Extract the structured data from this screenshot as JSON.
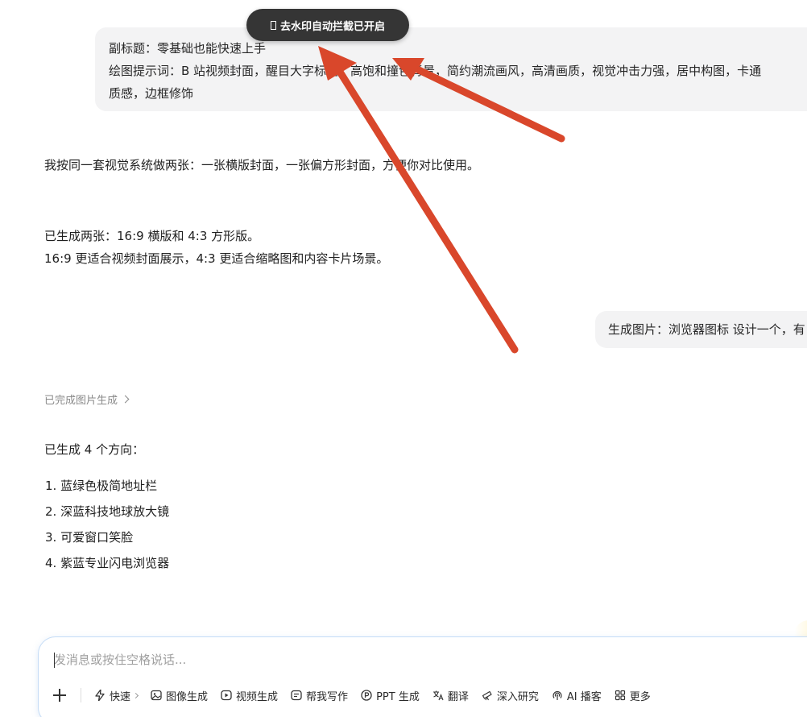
{
  "toast": {
    "text": "去水印自动拦截已开启"
  },
  "user_message_top": {
    "line1": "副标题：零基础也能快速上手",
    "line2": "绘图提示词：B 站视频封面，醒目大字标题，高饱和撞色背景，简约潮流画风，高清画质，视觉冲击力强，居中构图，卡通",
    "line3": "质感，边框修饰"
  },
  "ai_reply_1": {
    "text": "我按同一套视觉系统做两张：一张横版封面，一张偏方形封面，方便你对比使用。"
  },
  "ai_reply_2": {
    "line1": "已生成两张：16:9 横版和 4:3 方形版。",
    "line2": "16:9 更适合视频封面展示，4:3 更适合缩略图和内容卡片场景。"
  },
  "user_message_mid": {
    "text": "生成图片：浏览器图标 设计一个，有"
  },
  "done_link": {
    "text": "已完成图片生成"
  },
  "ai_reply_3": {
    "intro": "已生成 4 个方向：",
    "items": [
      "1. 蓝绿色极简地址栏",
      "2. 深蓝科技地球放大镜",
      "3. 可爱窗口笑脸",
      "4. 紫蓝专业闪电浏览器"
    ]
  },
  "composer": {
    "placeholder": "发消息或按住空格说话..."
  },
  "toolbar": {
    "quick": "快速",
    "image_gen": "图像生成",
    "video_gen": "视频生成",
    "writing": "帮我写作",
    "ppt": "PPT 生成",
    "translate": "翻译",
    "research": "深入研究",
    "podcast": "AI 播客",
    "more": "更多"
  },
  "colors": {
    "annotation_arrow": "#d9472b",
    "toast_bg": "#353535",
    "bubble_bg": "#f3f3f4",
    "composer_border": "#c5dcf6"
  }
}
